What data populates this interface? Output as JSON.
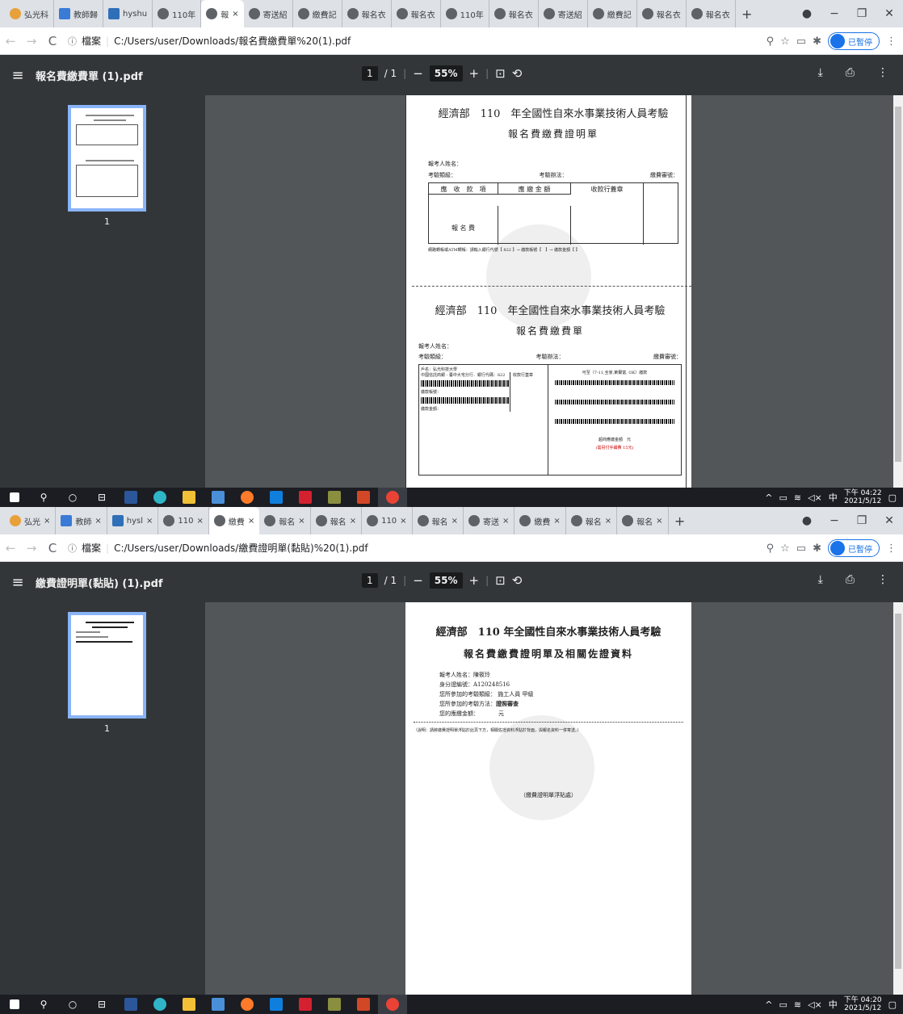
{
  "colors": {
    "accent": "#1a73e8",
    "pdf_toolbar": "#323639",
    "viewer_bg": "#525659",
    "taskbar": "#1b1d23",
    "red_text": "#cc0000"
  },
  "shot1": {
    "tabs": [
      "弘光科",
      "教師歸",
      "hyshu",
      "110年",
      "報",
      "寄送紹",
      "繳費記",
      "報名衣",
      "報名衣",
      "110年",
      "報名衣",
      "寄送紹",
      "繳費記",
      "報名衣",
      "報名衣"
    ],
    "active_tab_close": "×",
    "url": "C:/Users/user/Downloads/報名費繳費單%20(1).pdf",
    "url_prefix": "檔案",
    "paused_label": "已暫停",
    "pdf_title": "報名費繳費單 (1).pdf",
    "page_current": "1",
    "page_total": "/ 1",
    "zoom": "55%",
    "thumb_number": "1",
    "clock_time": "下午 04:22",
    "clock_date": "2021/5/12",
    "doc": {
      "title1": "經濟部　110　年全國性自來水事業技術人員考驗",
      "subtitle1": "報名費繳費證明單",
      "name_label": "報考人姓名：",
      "category_label": "考驗類級：",
      "method_label": "考驗辦法：",
      "audit_label": "繳費審號：",
      "col_item": "應　收　款　項",
      "col_amount": "應 繳 金 額",
      "col_stamp": "收款行蓋章",
      "row_item": "報 名 費",
      "atm_note": "網路轉帳或ATM轉帳：請輸入銀行代號【 822 】→ 繳款帳號【　】→ 繳款金額【 】",
      "title2": "經濟部　110　年全國性自來水事業技術人員考驗",
      "subtitle2": "報名費繳費單",
      "account_name": "戶名：弘光科技大學",
      "bank_line": "中國信託商銀 - 臺中大宅分行．銀行代碼：822",
      "stamp2": "收款行蓋章",
      "pay_no": "繳款帳號：",
      "pay_amount": "繳款金額：",
      "store_line": "可至（7-11,全家,萊爾富, OK）繳款",
      "store_amount": "超商應繳金額　元",
      "fee_note": "(需另付手續費 15元)"
    }
  },
  "shot2": {
    "tabs": [
      "弘光",
      "教師",
      "hysl",
      "110",
      "繳費",
      "報名",
      "報名",
      "110",
      "報名",
      "寄送",
      "繳費",
      "報名",
      "報名"
    ],
    "url": "C:/Users/user/Downloads/繳費證明單(黏貼)%20(1).pdf",
    "url_prefix": "檔案",
    "paused_label": "已暫停",
    "pdf_title": "繳費證明單(黏貼) (1).pdf",
    "page_current": "1",
    "page_total": "/ 1",
    "zoom": "55%",
    "thumb_number": "1",
    "clock_time": "下午 04:20",
    "clock_date": "2021/5/12",
    "doc": {
      "title": "經濟部　110 年全國性自來水事業技術人員考驗",
      "subtitle": "報名費繳費證明單及相關佐證資料",
      "name": "報考人姓名：陳筱玲",
      "id": "身分證編號：A120248516",
      "category": "您所參加的考驗類級： 施工人員 甲級",
      "method_label": "您所參加的考驗方法：",
      "method_value": "證照審查",
      "amount_label": "您的應繳金額：",
      "amount_unit": "元",
      "note": "（說明：請將繳費證明單浮貼於此頁下方，相關佐證資料浮貼於背面，與報名資料一併寄送。）",
      "paste_here": "（繳費證明單浮貼處）"
    }
  }
}
